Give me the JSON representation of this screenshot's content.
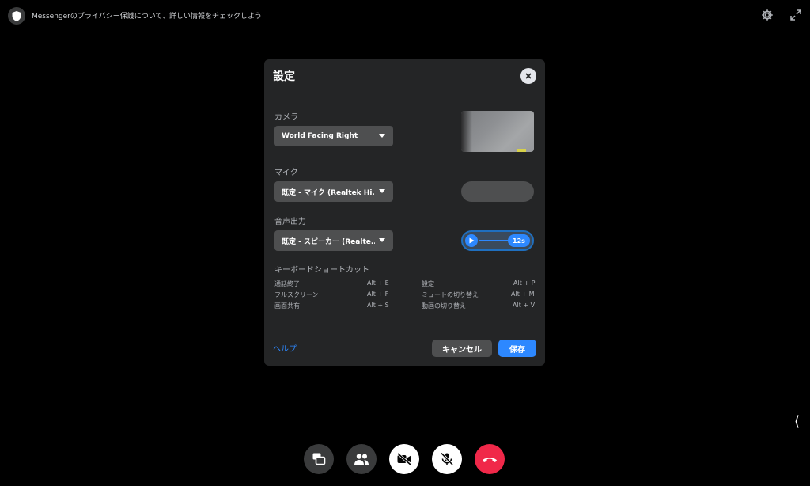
{
  "topbar": {
    "privacy_text": "Messengerのプライバシー保護について、詳しい情報をチェックしよう"
  },
  "dialog": {
    "title": "設定",
    "camera": {
      "label": "カメラ",
      "selected": "World Facing Right"
    },
    "mic": {
      "label": "マイク",
      "selected": "既定 - マイク (Realtek Hi..."
    },
    "speaker": {
      "label": "音声出力",
      "selected": "既定 - スピーカー (Realte...",
      "test_time": "12s"
    },
    "shortcuts": {
      "title": "キーボードショートカット",
      "left": [
        {
          "name": "通話終了",
          "key": "Alt + E"
        },
        {
          "name": "フルスクリーン",
          "key": "Alt + F"
        },
        {
          "name": "画面共有",
          "key": "Alt + S"
        }
      ],
      "right": [
        {
          "name": "設定",
          "key": "Alt + P"
        },
        {
          "name": "ミュートの切り替え",
          "key": "Alt + M"
        },
        {
          "name": "動画の切り替え",
          "key": "Alt + V"
        }
      ]
    },
    "help_label": "ヘルプ",
    "cancel_label": "キャンセル",
    "save_label": "保存"
  },
  "side_chevron": "⟨",
  "colors": {
    "accent": "#2d88ff",
    "end_call": "#f02849",
    "dialog_bg": "#242526"
  },
  "call_controls": [
    "screen-share-icon",
    "participants-icon",
    "camera-off-icon",
    "mic-off-icon",
    "end-call-icon"
  ]
}
